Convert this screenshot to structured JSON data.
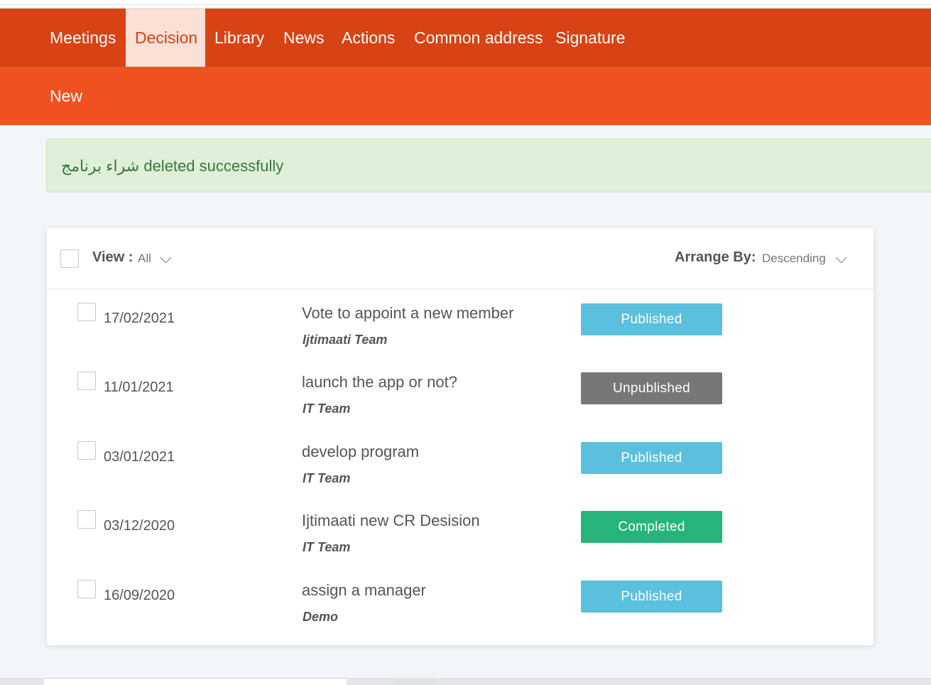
{
  "nav": {
    "items": [
      {
        "label": "Meetings",
        "active": false
      },
      {
        "label": "Decision",
        "active": true
      },
      {
        "label": "Library",
        "active": false
      },
      {
        "label": "News",
        "active": false
      },
      {
        "label": "Actions",
        "active": false
      },
      {
        "label": "Common address",
        "active": false
      },
      {
        "label": "Signature",
        "active": false
      }
    ]
  },
  "subnav": {
    "new_label": "New"
  },
  "alert": {
    "message": "شراء برنامج deleted successfully"
  },
  "list": {
    "view_label": "View :",
    "view_value": "All",
    "arrange_label": "Arrange By:",
    "arrange_value": "Descending",
    "rows": [
      {
        "date": "17/02/2021",
        "title": "Vote to appoint a new member",
        "team": "Ijtimaati Team",
        "status": "Published"
      },
      {
        "date": "11/01/2021",
        "title": "launch the app or not?",
        "team": "IT Team",
        "status": "Unpublished"
      },
      {
        "date": "03/01/2021",
        "title": "develop program",
        "team": "IT Team",
        "status": "Published"
      },
      {
        "date": "03/12/2020",
        "title": "Ijtimaati new CR Desision",
        "team": "IT Team",
        "status": "Completed"
      },
      {
        "date": "16/09/2020",
        "title": "assign a manager",
        "team": "Demo",
        "status": "Published"
      }
    ]
  },
  "colors": {
    "nav_bg": "#d84315",
    "subnav_bg": "#ef5121",
    "active_tab_bg": "#fbe0d6",
    "published": "#5bc0de",
    "unpublished": "#777777",
    "completed": "#26b47c",
    "alert_bg": "#dff0d8",
    "alert_text": "#3c763d"
  }
}
